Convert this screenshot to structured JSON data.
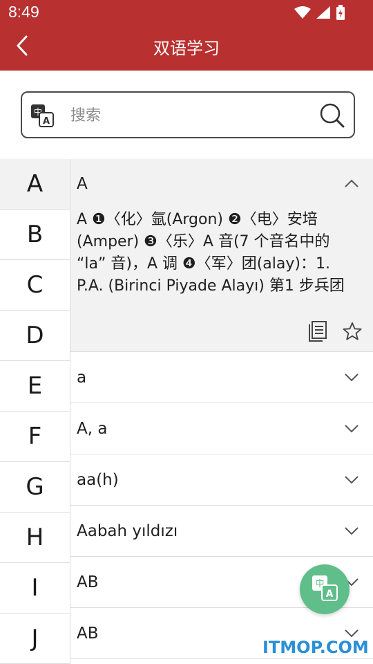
{
  "status_bar": {
    "time": "8:49",
    "icons": [
      "wifi-icon",
      "signal-icon",
      "battery-icon"
    ]
  },
  "app_bar": {
    "title": "双语学习",
    "back_icon": "back-arrow-icon"
  },
  "search": {
    "placeholder": "搜索",
    "lang_icon": "translate-icon",
    "search_icon": "search-icon"
  },
  "index": [
    "A",
    "B",
    "C",
    "D",
    "E",
    "F",
    "G",
    "H",
    "I",
    "J"
  ],
  "active_index": "A",
  "entries": [
    {
      "headword": "A",
      "expanded": true,
      "definition": "A ❶〈化〉氩(Argon) ❷〈电〉安培(Amper) ❸〈乐〉A 音(7 个音名中的 “la” 音)，A 调 ❹〈军〉团(alay)：1. P.A. (Birinci Piyade Alayı) 第1 步兵团"
    },
    {
      "headword": "a",
      "expanded": false
    },
    {
      "headword": "A, a",
      "expanded": false
    },
    {
      "headword": "aa(h)",
      "expanded": false
    },
    {
      "headword": "Aabah yıldızı",
      "expanded": false
    },
    {
      "headword": "AB",
      "expanded": false
    },
    {
      "headword": "AB",
      "expanded": false
    }
  ],
  "colors": {
    "primary": "#b83030",
    "fab": "#5fbe8a",
    "watermark": "#2a8fd6"
  },
  "watermark": "ITMOP.COM"
}
